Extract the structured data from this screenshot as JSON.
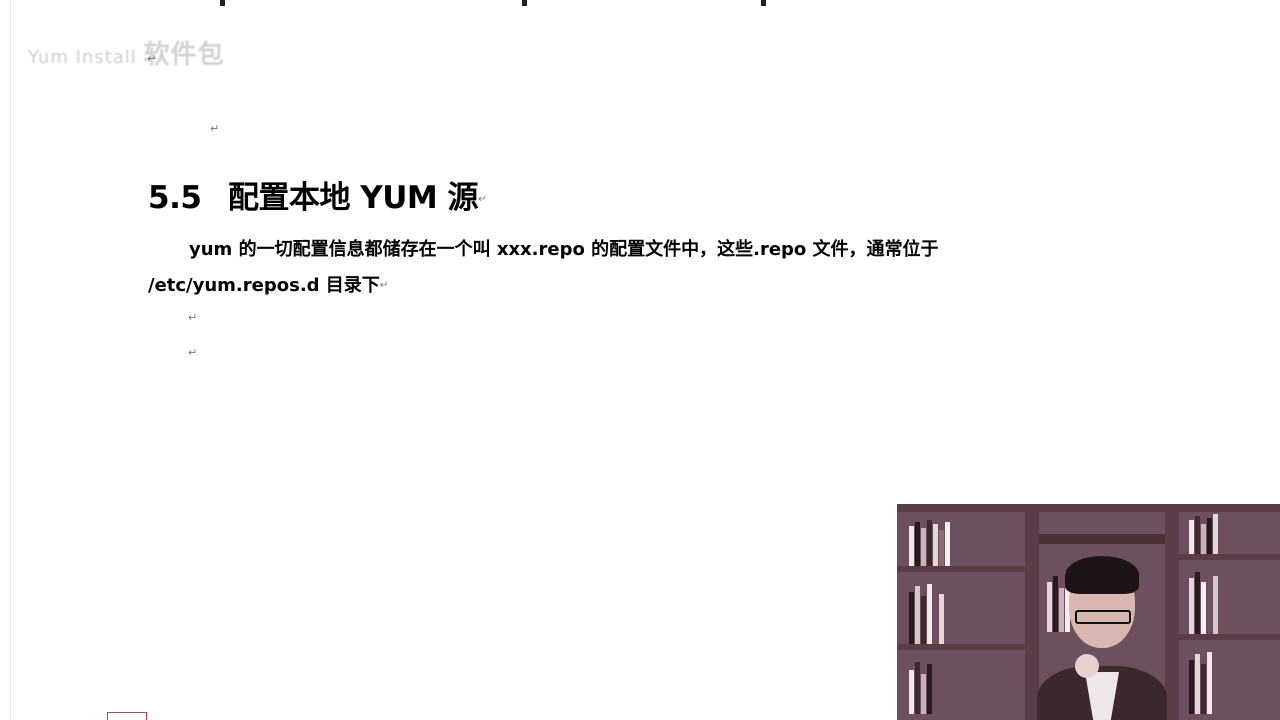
{
  "document": {
    "blurred_line": {
      "faint_text": "Yum Install",
      "bold_text": "软件包"
    },
    "para_mark": "↵",
    "heading": {
      "number": "5.5",
      "title": "配置本地 YUM 源"
    },
    "body": {
      "line1": "yum 的一切配置信息都储存在一个叫 xxx.repo 的配置文件中，这些.repo 文件，通常位于",
      "line2": "/etc/yum.repos.d 目录下"
    }
  },
  "webcam": {
    "icon": "presenter-video"
  }
}
